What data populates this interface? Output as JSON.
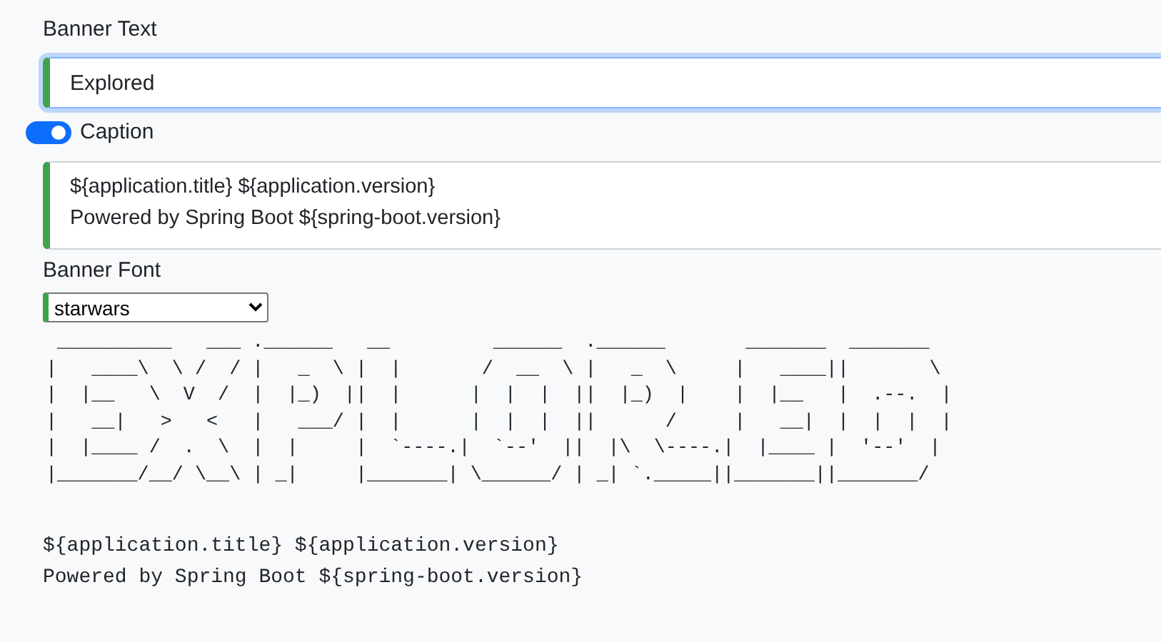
{
  "banner_text": {
    "label": "Banner Text",
    "value": "Explored",
    "focused": true
  },
  "caption": {
    "label": "Caption",
    "on": true,
    "lines": [
      "${application.title} ${application.version}",
      "Powered by Spring Boot ${spring-boot.version}"
    ]
  },
  "banner_font": {
    "label": "Banner Font",
    "value": "starwars"
  },
  "banner_art": [
    " __________   ___ .______   __         ______  .______       _______  _______  ",
    "|   ____\\  \\ /  / |   _  \\ |  |       /  __  \\ |   _  \\     |   ____||       \\ ",
    "|  |__   \\  V  /  |  |_)  ||  |      |  |  |  ||  |_)  |    |  |__   |  .--.  |",
    "|   __|   >   <   |   ___/ |  |      |  |  |  ||      /     |   __|  |  |  |  |",
    "|  |____ /  .  \\  |  |     |  `----.|  `--'  ||  |\\  \\----.|  |____ |  '--'  |",
    "|_______/__/ \\__\\ | _|     |_______| \\______/ | _| `._____||_______||_______/ "
  ],
  "output_lines": [
    "${application.title} ${application.version}",
    "Powered by Spring Boot ${spring-boot.version}"
  ]
}
